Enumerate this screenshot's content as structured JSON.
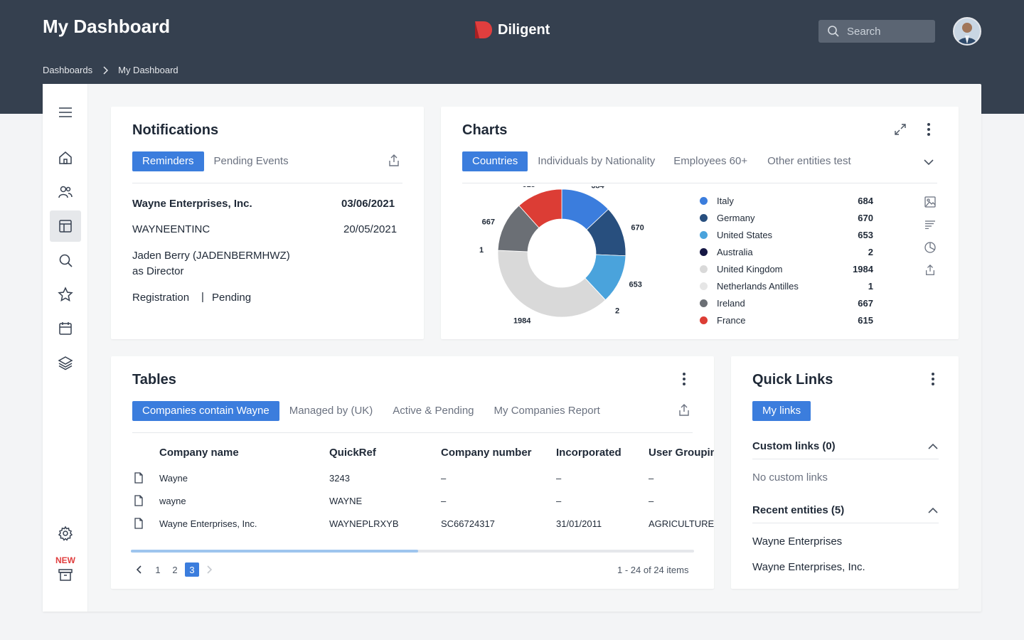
{
  "header": {
    "title": "My Dashboard",
    "brand": "Diligent",
    "search_placeholder": "Search",
    "colors": {
      "bar": "#35404f",
      "accent": "#3b7ddd",
      "logo": "#e03e3e"
    }
  },
  "breadcrumb": {
    "items": [
      "Dashboards",
      "My Dashboard"
    ]
  },
  "sidebar": {
    "items": [
      "menu-icon",
      "home-icon",
      "users-icon",
      "dashboard-icon",
      "search-icon",
      "star-icon",
      "calendar-icon",
      "layers-icon"
    ],
    "active": "dashboard-icon",
    "settings": "gear-icon",
    "new_label": "NEW",
    "archive": "archive-icon"
  },
  "notifications": {
    "title": "Notifications",
    "tabs": [
      "Reminders",
      "Pending Events"
    ],
    "active_tab": "Reminders",
    "rows": [
      {
        "left": "Wayne Enterprises, Inc.",
        "right": "03/06/2021"
      },
      {
        "left": "WAYNEENTINC",
        "right": "20/05/2021"
      }
    ],
    "person_line1": "Jaden Berry (JADENBERMHWZ)",
    "person_line2": "as Director",
    "event_type": "Registration",
    "separator": "|",
    "event_status": "Pending"
  },
  "charts": {
    "title": "Charts",
    "tabs": [
      "Countries",
      "Individuals by Nationality",
      "Employees 60+",
      "Other entities test"
    ],
    "active_tab": "Countries",
    "side_icons": [
      "image-icon",
      "sort-icon",
      "pie-chart-icon",
      "share-icon"
    ]
  },
  "chart_data": {
    "type": "pie",
    "donut": true,
    "categories": [
      "Italy",
      "Germany",
      "United States",
      "Australia",
      "United Kingdom",
      "Netherlands Antilles",
      "Ireland",
      "France"
    ],
    "values": [
      684,
      670,
      653,
      2,
      1984,
      1,
      667,
      615
    ],
    "colors": [
      "#3b7ddd",
      "#284f7e",
      "#4aa3dc",
      "#151744",
      "#d9d9d9",
      "#e6e6e6",
      "#6b6f75",
      "#dc3d35"
    ],
    "legend_position": "right"
  },
  "tables": {
    "title": "Tables",
    "tabs": [
      "Companies contain Wayne",
      "Managed by (UK)",
      "Active & Pending",
      "My Companies Report"
    ],
    "active_tab": "Companies contain Wayne",
    "columns": [
      "Company name",
      "QuickRef",
      "Company number",
      "Incorporated",
      "User Groupin"
    ],
    "rows": [
      [
        "Wayne",
        "3243",
        "–",
        "–",
        "–"
      ],
      [
        "wayne",
        "WAYNE",
        "–",
        "–",
        "–"
      ],
      [
        "Wayne Enterprises, Inc.",
        "WAYNEPLRXYB",
        "SC66724317",
        "31/01/2011",
        "AGRICULTURE"
      ]
    ],
    "scroll_fraction": 0.51,
    "pages": [
      "1",
      "2",
      "3"
    ],
    "current_page": "3",
    "summary": "1 - 24 of 24 items"
  },
  "quick_links": {
    "title": "Quick Links",
    "tab": "My links",
    "custom_title": "Custom links (0)",
    "custom_empty": "No custom links",
    "recent_title": "Recent entities (5)",
    "recent_items": [
      "Wayne Enterprises",
      "Wayne Enterprises, Inc."
    ]
  }
}
